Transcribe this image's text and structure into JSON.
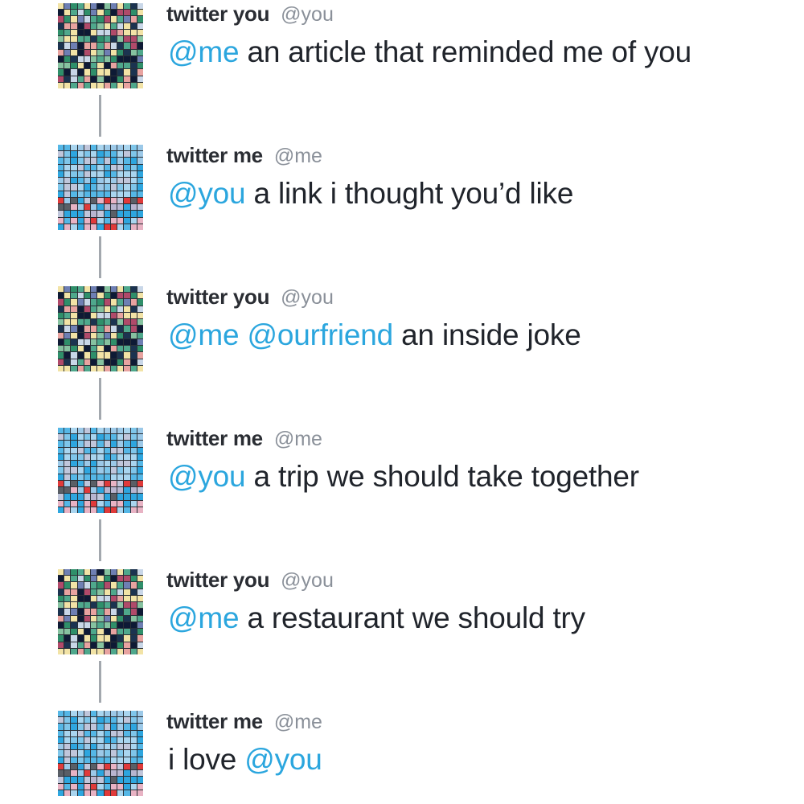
{
  "tweets": [
    {
      "user": "you",
      "name": "twitter you",
      "handle": "@you",
      "segments": [
        {
          "type": "mention",
          "text": "@me"
        },
        {
          "type": "text",
          "text": " an article that reminded me of you"
        }
      ]
    },
    {
      "user": "me",
      "name": "twitter me",
      "handle": "@me",
      "segments": [
        {
          "type": "mention",
          "text": "@you"
        },
        {
          "type": "text",
          "text": " a link i thought you’d like"
        }
      ]
    },
    {
      "user": "you",
      "name": "twitter you",
      "handle": "@you",
      "segments": [
        {
          "type": "mention",
          "text": "@me"
        },
        {
          "type": "text",
          "text": " "
        },
        {
          "type": "mention",
          "text": "@ourfriend"
        },
        {
          "type": "text",
          "text": "  an inside joke"
        }
      ]
    },
    {
      "user": "me",
      "name": "twitter me",
      "handle": "@me",
      "segments": [
        {
          "type": "mention",
          "text": "@you"
        },
        {
          "type": "text",
          "text": " a trip we should take together"
        }
      ]
    },
    {
      "user": "you",
      "name": "twitter you",
      "handle": "@you",
      "segments": [
        {
          "type": "mention",
          "text": "@me"
        },
        {
          "type": "text",
          "text": " a restaurant we should try"
        }
      ]
    },
    {
      "user": "me",
      "name": "twitter me",
      "handle": "@me",
      "segments": [
        {
          "type": "text",
          "text": "i love "
        },
        {
          "type": "mention",
          "text": "@you"
        }
      ]
    }
  ],
  "colors": {
    "mention": "#2ba6de",
    "name": "#2a2d33",
    "handle": "#8a9099",
    "text": "#20242b",
    "connector": "#a3a8ae"
  },
  "avatars": {
    "you": {
      "icon": "pixel-mosaic-avatar",
      "palette": [
        "#0e1a35",
        "#2f8f6a",
        "#4fa88c",
        "#e8a3a0",
        "#f2e3a6",
        "#6e7fb3",
        "#c9d7e8",
        "#1b3350",
        "#86c2a0",
        "#b04a6a"
      ]
    },
    "me": {
      "icon": "pixel-mosaic-avatar",
      "palette": [
        "#2ea6df",
        "#55b7e6",
        "#9cc9e8",
        "#c0c6db",
        "#b8b5cf",
        "#e8b3c4",
        "#e03a3a",
        "#5a5f66",
        "#7fc6ea",
        "#a9d5ef"
      ]
    }
  }
}
